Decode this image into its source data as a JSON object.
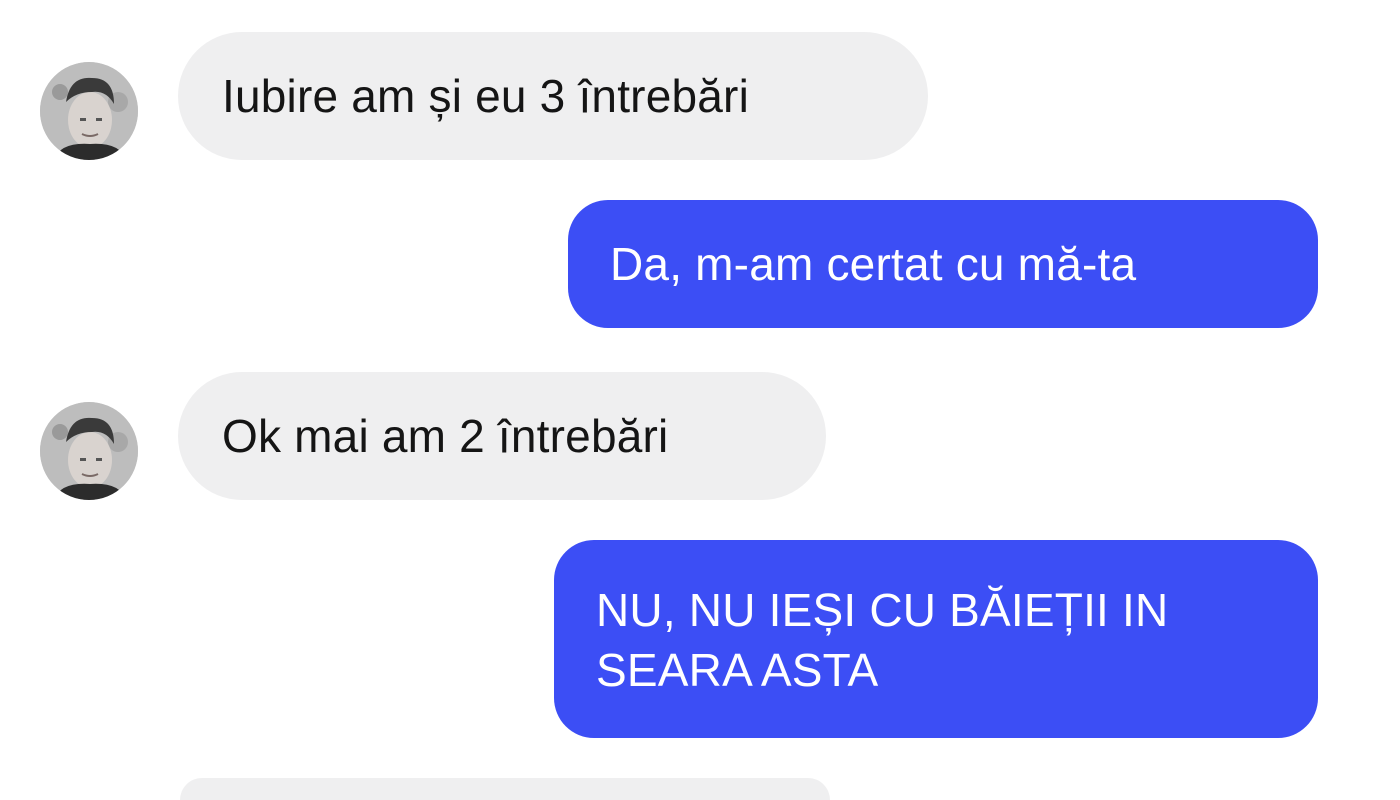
{
  "conversation": {
    "messages": [
      {
        "direction": "incoming",
        "text": "Iubire am și eu 3 întrebări"
      },
      {
        "direction": "outgoing",
        "text": "Da, m-am certat cu mă-ta"
      },
      {
        "direction": "incoming",
        "text": "Ok mai am 2 întrebări"
      },
      {
        "direction": "outgoing",
        "text": "NU, NU IEȘI CU BĂIEȚII IN SEARA ASTA"
      },
      {
        "direction": "incoming",
        "text": ""
      }
    ]
  },
  "colors": {
    "incoming_bubble": "#efeff0",
    "outgoing_bubble": "#3c4ef5",
    "background": "#ffffff"
  },
  "icons": {
    "contact_avatar": "contact-avatar-icon"
  }
}
